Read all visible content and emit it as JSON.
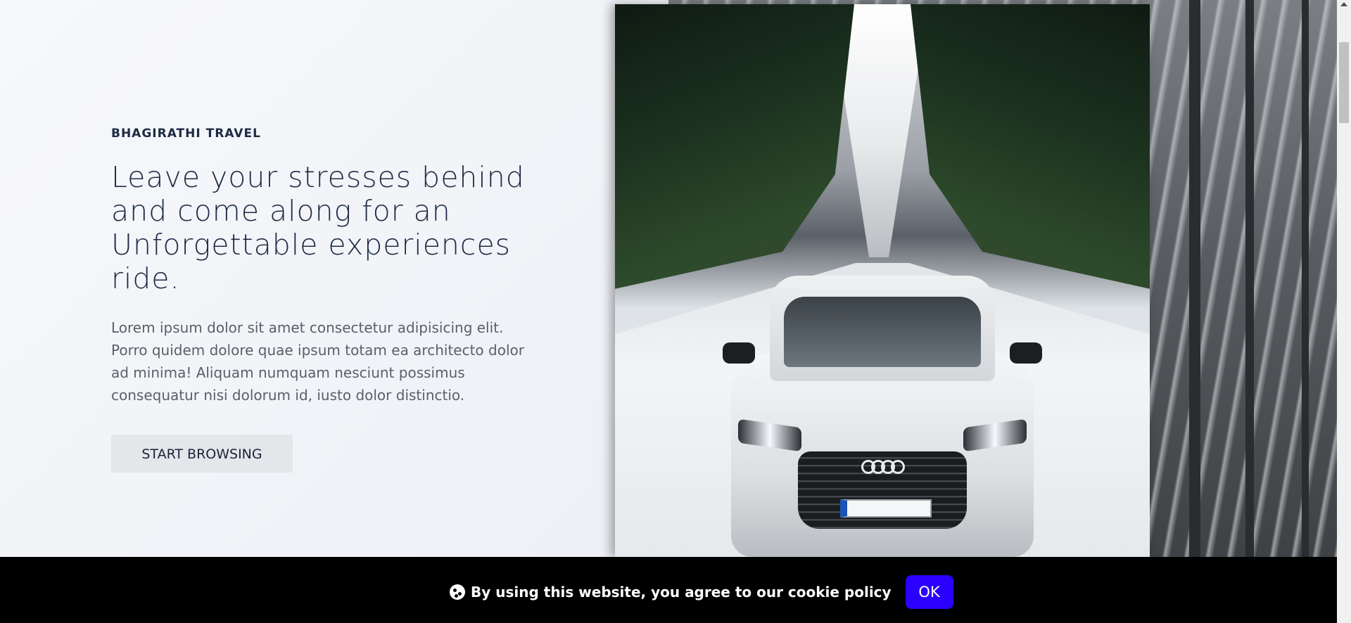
{
  "hero": {
    "brand": "BHAGIRATHI TRAVEL",
    "headline": "Leave your stresses behind and come along for an Unforgettable experiences ride.",
    "description": "Lorem ipsum dolor sit amet consectetur adipisicing elit. Porro quidem dolore quae ipsum totam ea architecto dolor ad minima! Aliquam numquam nesciunt possimus consequatur nisi dolorum id, iusto dolor distinctio.",
    "cta_label": "START BROWSING"
  },
  "cookie": {
    "icon": "cookie-icon",
    "message": "By using this website, you agree to our cookie policy",
    "ok_label": "OK"
  },
  "colors": {
    "cta_background": "#e4e6ea",
    "cookie_bar": "#000000",
    "ok_button": "#2b00ff",
    "text_dark": "#1e2c45"
  }
}
